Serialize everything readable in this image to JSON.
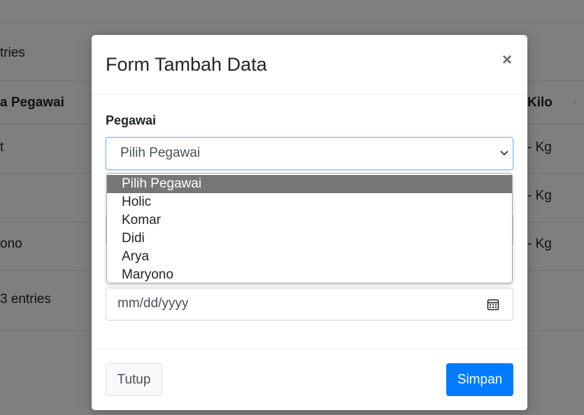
{
  "background": {
    "entries_fragment": "tries",
    "column_pegawai": "a Pegawai",
    "column_kilo": "Kilo",
    "row1_left": "t",
    "row1_right": "- Kg",
    "row2_right": "- Kg",
    "row3_left": "ono",
    "row3_right": "- Kg",
    "footer_entries": "3 entries"
  },
  "modal": {
    "title": "Form Tambah Data",
    "close_symbol": "×",
    "pegawai_label": "Pegawai",
    "pegawai_select_value": "Pilih Pegawai",
    "date_placeholder": "mm/dd/yyyy",
    "close_button": "Tutup",
    "save_button": "Simpan"
  },
  "dropdown": {
    "options": [
      {
        "label": "Pilih Pegawai",
        "selected": true
      },
      {
        "label": "Holic",
        "selected": false
      },
      {
        "label": "Komar",
        "selected": false
      },
      {
        "label": "Didi",
        "selected": false
      },
      {
        "label": "Arya",
        "selected": false
      },
      {
        "label": "Maryono",
        "selected": false
      }
    ]
  },
  "colors": {
    "primary": "#007bff",
    "highlight": "#767676"
  }
}
